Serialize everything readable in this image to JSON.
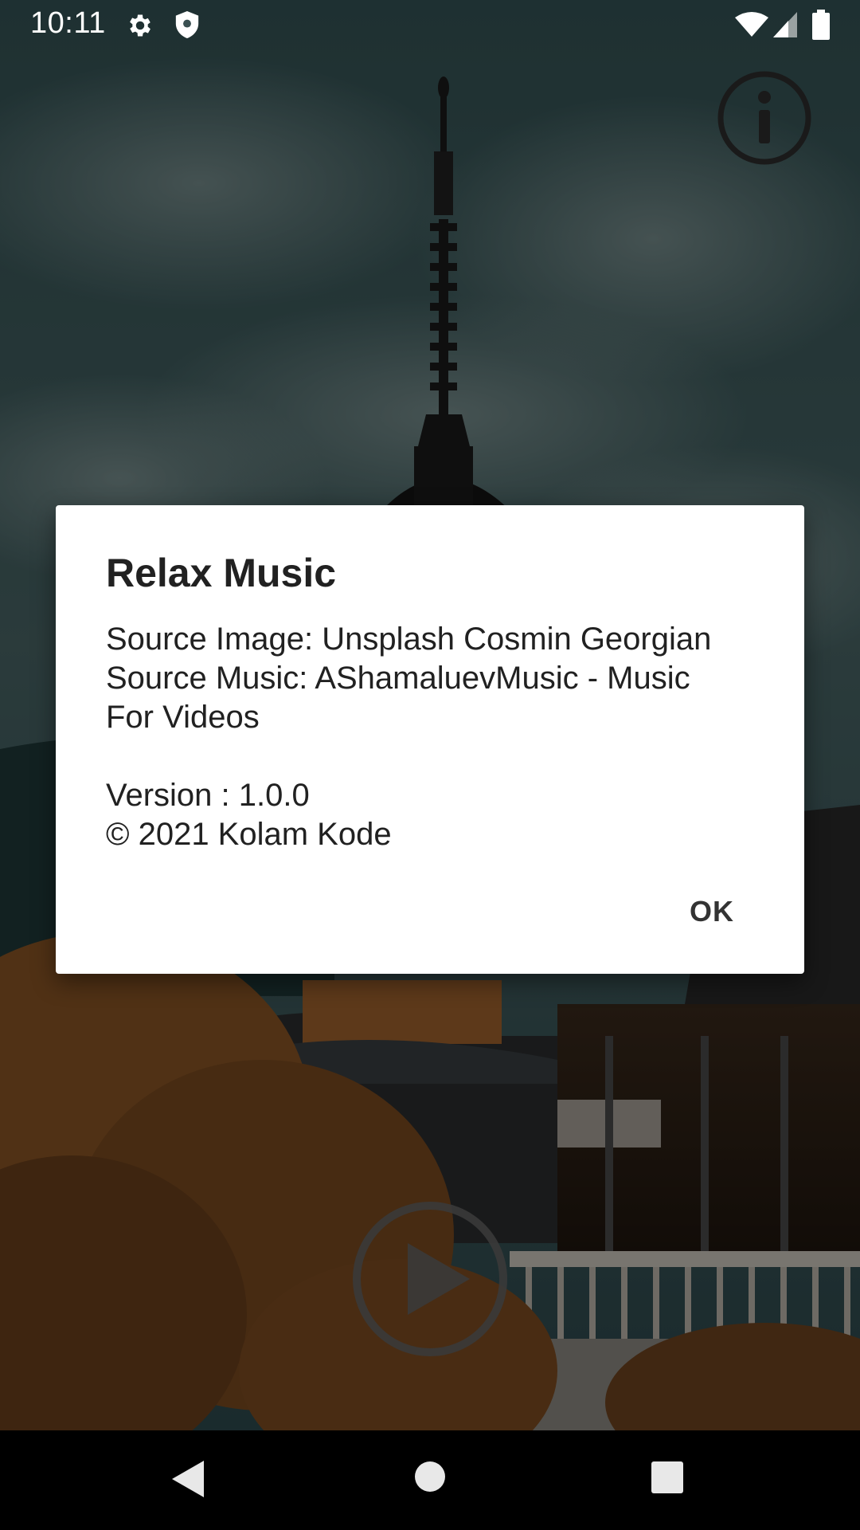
{
  "status_bar": {
    "time": "10:11",
    "left_icons": [
      "settings-icon",
      "shield-icon"
    ],
    "right_icons": [
      "wifi-icon",
      "cell-signal-icon",
      "battery-icon"
    ]
  },
  "top_actions": {
    "info_icon": "info-icon"
  },
  "player": {
    "play_icon": "play-icon"
  },
  "dialog": {
    "title": "Relax Music",
    "lines": [
      "Source Image: Unsplash Cosmin Georgian",
      "Source Music: AShamaluevMusic - Music",
      "For Videos",
      "",
      "Version : 1.0.0",
      "© 2021 Kolam Kode"
    ],
    "ok_label": "OK"
  },
  "nav_bar": {
    "buttons": [
      "back-icon",
      "home-icon",
      "recents-icon"
    ]
  },
  "colors": {
    "dialog_bg": "#ffffff",
    "dialog_text": "#212121",
    "scrim": "#000000",
    "sky": "#3f5c5f",
    "foliage": "#7a4a20"
  }
}
